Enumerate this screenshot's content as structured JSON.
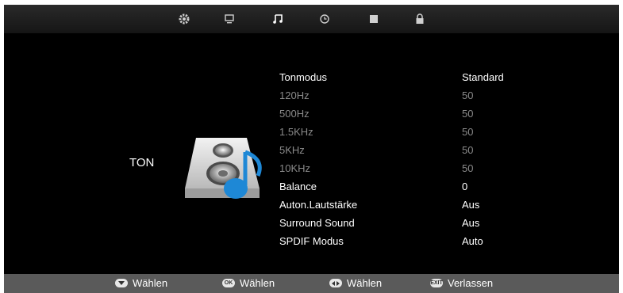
{
  "tabs": [
    {
      "icon": "gear-icon"
    },
    {
      "icon": "monitor-icon"
    },
    {
      "icon": "music-note-icon"
    },
    {
      "icon": "clock-icon"
    },
    {
      "icon": "square-icon"
    },
    {
      "icon": "lock-icon"
    }
  ],
  "page": {
    "title": "TON",
    "speaker_icon": "speaker-music-icon"
  },
  "menu": [
    {
      "label": "Tonmodus",
      "value": "Standard",
      "enabled": true
    },
    {
      "label": "120Hz",
      "value": "50",
      "enabled": false
    },
    {
      "label": "500Hz",
      "value": "50",
      "enabled": false
    },
    {
      "label": "1.5KHz",
      "value": "50",
      "enabled": false
    },
    {
      "label": "5KHz",
      "value": "50",
      "enabled": false
    },
    {
      "label": "10KHz",
      "value": "50",
      "enabled": false
    },
    {
      "label": "Balance",
      "value": "0",
      "enabled": true
    },
    {
      "label": "Auton.Lautstärke",
      "value": "Aus",
      "enabled": true
    },
    {
      "label": "Surround Sound",
      "value": "Aus",
      "enabled": true
    },
    {
      "label": "SPDIF Modus",
      "value": "Auto",
      "enabled": true
    }
  ],
  "bottom_hints": [
    {
      "icon": "down-arrow-icon",
      "key": "",
      "label": "Wählen"
    },
    {
      "icon": "ok-key-icon",
      "key": "OK",
      "label": "Wählen"
    },
    {
      "icon": "left-right-arrow-icon",
      "key": "",
      "label": "Wählen"
    },
    {
      "icon": "exit-key-icon",
      "key": "EXIT",
      "label": "Verlassen"
    }
  ],
  "colors": {
    "background": "#000000",
    "bar": "#5a5a5a",
    "accent_blue": "#1e88d6",
    "text": "#ffffff",
    "disabled": "#8a8a8a"
  }
}
